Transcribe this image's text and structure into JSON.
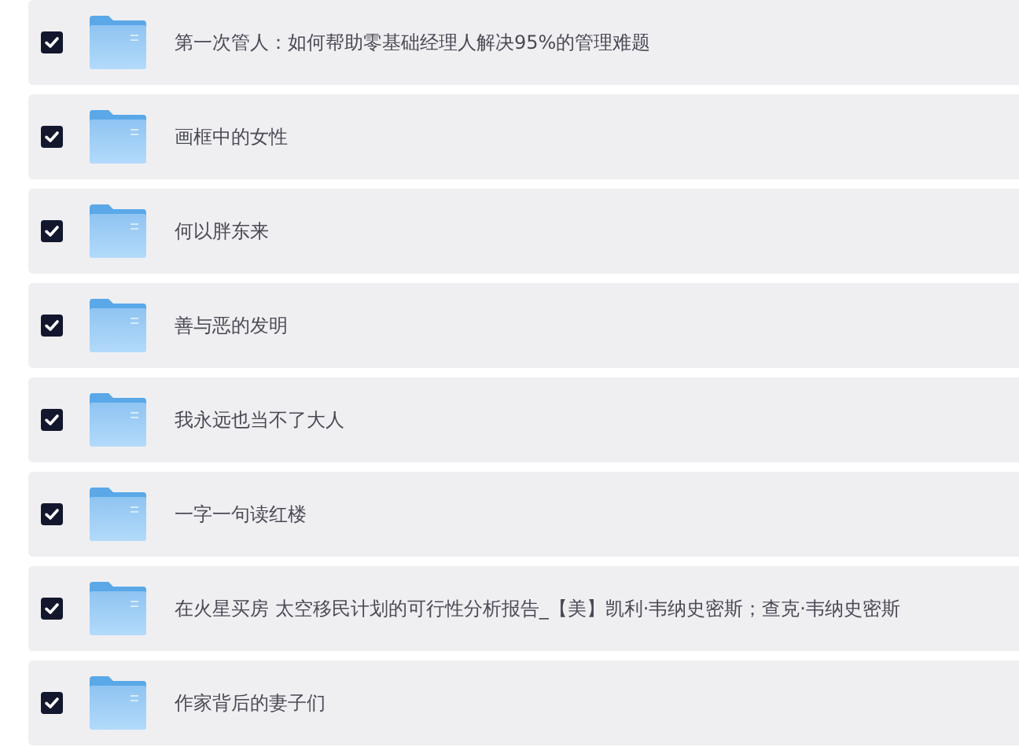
{
  "items": [
    {
      "title": "第一次管人：如何帮助零基础经理人解决95%的管理难题",
      "checked": true
    },
    {
      "title": "画框中的女性",
      "checked": true
    },
    {
      "title": "何以胖东来",
      "checked": true
    },
    {
      "title": "善与恶的发明",
      "checked": true
    },
    {
      "title": "我永远也当不了大人",
      "checked": true
    },
    {
      "title": "一字一句读红楼",
      "checked": true
    },
    {
      "title": "在火星买房 太空移民计划的可行性分析报告_【美】凯利·韦纳史密斯；查克·韦纳史密斯",
      "checked": true
    },
    {
      "title": "作家背后的妻子们",
      "checked": true
    }
  ]
}
